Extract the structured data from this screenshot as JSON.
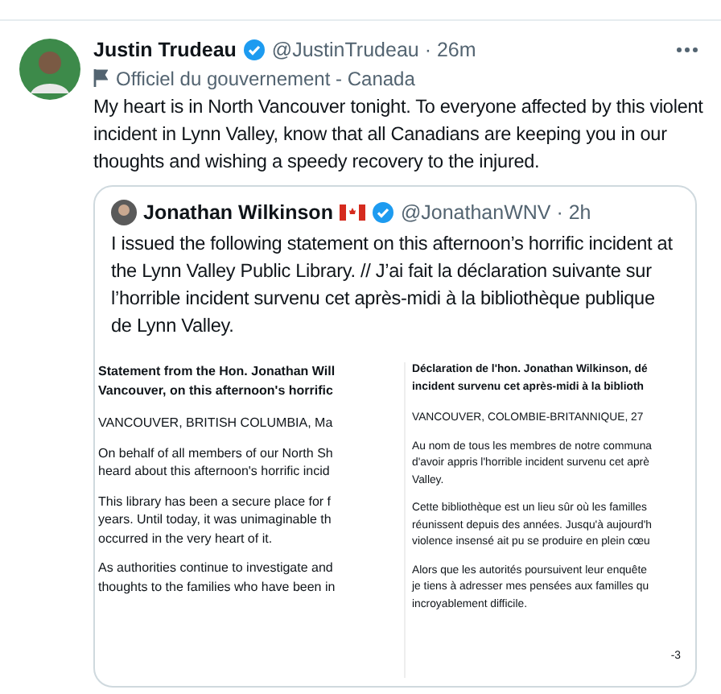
{
  "tweet": {
    "author": {
      "name": "Justin Trudeau",
      "verified": true,
      "meta": "@JustinTrudeau · 26m"
    },
    "label": "Officiel du gouvernement - Canada",
    "text": "My heart is in North Vancouver tonight. To everyone affected by this violent incident in Lynn Valley, know that all Canadians are keeping you in our thoughts and wishing a speedy recovery to the injured.",
    "quote": {
      "author": {
        "name": "Jonathan Wilkinson",
        "flag": true,
        "verified": true,
        "meta": "@JonathanWNV · 2h"
      },
      "text": "I issued the following statement on this afternoon’s horrific incident at the Lynn Valley Public Library. // J’ai fait la déclaration suivante sur l’horrible incident survenu cet après-midi à la bibliothèque publique de Lynn Valley.",
      "documents": [
        {
          "paragraphs": [
            {
              "kind": "heading",
              "lines": [
                "Statement from the Hon. Jonathan Will",
                "Vancouver, on this afternoon's horrific"
              ]
            },
            {
              "kind": "body",
              "lines": [
                "VANCOUVER, BRITISH COLUMBIA, Ma"
              ]
            },
            {
              "kind": "body",
              "lines": [
                "On behalf of all members of our North Sh",
                "heard about this afternoon's horrific incid"
              ]
            },
            {
              "kind": "body",
              "lines": [
                "This library has been a secure place for f",
                "years. Until today, it was unimaginable th",
                "occurred in the very heart of it."
              ]
            },
            {
              "kind": "body",
              "lines": [
                "As authorities continue to investigate and",
                "thoughts to the families who have been in"
              ]
            }
          ]
        },
        {
          "paragraphs": [
            {
              "kind": "heading",
              "lines": [
                "Déclaration de l'hon. Jonathan Wilkinson, dé",
                "incident survenu cet après-midi à la biblioth"
              ]
            },
            {
              "kind": "body",
              "lines": [
                "VANCOUVER, COLOMBIE-BRITANNIQUE, 27"
              ]
            },
            {
              "kind": "body",
              "lines": [
                "Au nom de tous les membres de notre communa",
                "d'avoir appris l'horrible incident survenu cet aprè",
                "Valley."
              ]
            },
            {
              "kind": "body",
              "lines": [
                "Cette bibliothèque est un lieu sûr où les familles",
                "réunissent depuis des années. Jusqu'à aujourd'h",
                "violence insensé ait pu se produire en plein cœu"
              ]
            },
            {
              "kind": "body",
              "lines": [
                "Alors que les autorités poursuivent leur enquête",
                "je tiens à adresser mes pensées aux familles qu",
                "incroyablement difficile."
              ]
            },
            {
              "kind": "signature",
              "lines": [
                "-3"
              ]
            }
          ]
        }
      ]
    }
  }
}
